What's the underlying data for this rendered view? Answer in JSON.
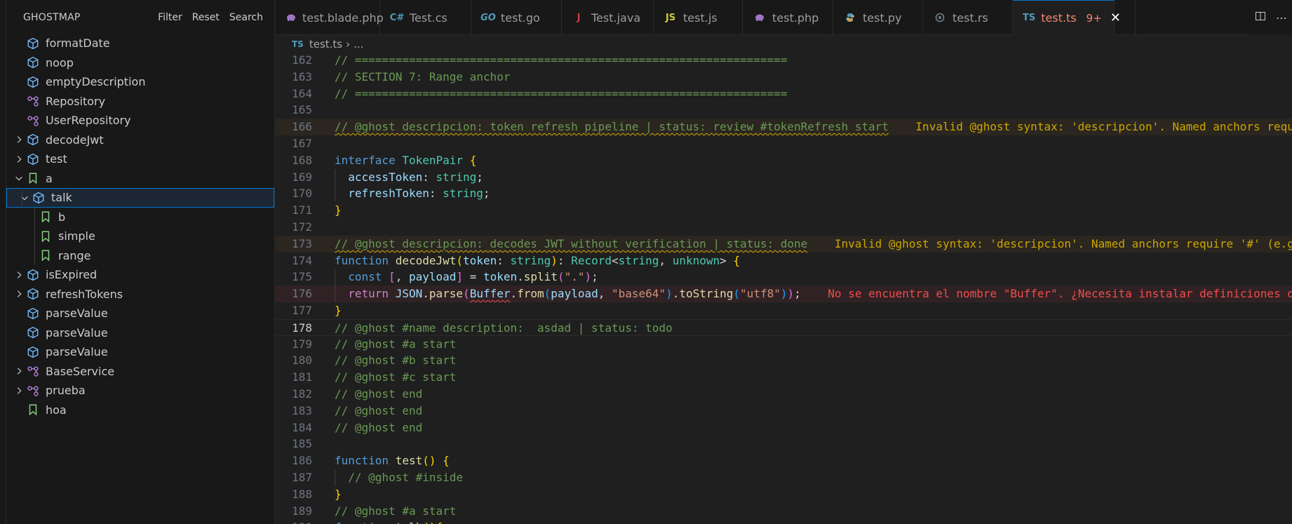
{
  "sidebar": {
    "title": "GHOSTMAP",
    "actions": {
      "filter": "Filter",
      "reset": "Reset",
      "search": "Search"
    },
    "items": [
      {
        "label": "formatDate",
        "icon": "cube-icon",
        "expand": "none",
        "depth": 0
      },
      {
        "label": "noop",
        "icon": "cube-icon",
        "expand": "none",
        "depth": 0
      },
      {
        "label": "emptyDescription",
        "icon": "cube-icon",
        "expand": "none",
        "depth": 0
      },
      {
        "label": "Repository",
        "icon": "class-icon",
        "expand": "none",
        "depth": 0
      },
      {
        "label": "UserRepository",
        "icon": "class-icon",
        "expand": "none",
        "depth": 0
      },
      {
        "label": "decodeJwt",
        "icon": "cube-icon",
        "expand": "collapsed",
        "depth": 0
      },
      {
        "label": "test",
        "icon": "cube-icon",
        "expand": "collapsed",
        "depth": 0
      },
      {
        "label": "a",
        "icon": "bookmark-icon",
        "expand": "expanded",
        "depth": 0
      },
      {
        "label": "talk",
        "icon": "cube-icon",
        "expand": "expanded",
        "depth": 1,
        "selected": true
      },
      {
        "label": "b",
        "icon": "bookmark-icon",
        "expand": "none",
        "depth": 2
      },
      {
        "label": "simple",
        "icon": "bookmark-icon",
        "expand": "none",
        "depth": 2
      },
      {
        "label": "range",
        "icon": "bookmark-icon",
        "expand": "none",
        "depth": 2
      },
      {
        "label": "isExpired",
        "icon": "cube-icon",
        "expand": "collapsed",
        "depth": 0
      },
      {
        "label": "refreshTokens",
        "icon": "cube-icon",
        "expand": "collapsed",
        "depth": 0
      },
      {
        "label": "parseValue",
        "icon": "cube-icon",
        "expand": "none",
        "depth": 0
      },
      {
        "label": "parseValue",
        "icon": "cube-icon",
        "expand": "none",
        "depth": 0
      },
      {
        "label": "parseValue",
        "icon": "cube-icon",
        "expand": "none",
        "depth": 0
      },
      {
        "label": "BaseService",
        "icon": "class-icon",
        "expand": "collapsed",
        "depth": 0
      },
      {
        "label": "prueba",
        "icon": "class-icon",
        "expand": "collapsed",
        "depth": 0
      },
      {
        "label": "hoa",
        "icon": "bookmark-icon",
        "expand": "none",
        "depth": 0
      }
    ]
  },
  "tabs": [
    {
      "label": "test.blade.php",
      "icon": "elephant-icon",
      "icon_color": "#a074c4"
    },
    {
      "label": "Test.cs",
      "icon": "csharp-icon",
      "icon_color": "#519aba"
    },
    {
      "label": "test.go",
      "icon": "go-icon",
      "icon_color": "#519aba"
    },
    {
      "label": "Test.java",
      "icon": "java-icon",
      "icon_color": "#cc3e44"
    },
    {
      "label": "test.js",
      "icon": "js-icon",
      "icon_color": "#cbcb41"
    },
    {
      "label": "test.php",
      "icon": "elephant-icon",
      "icon_color": "#a074c4"
    },
    {
      "label": "test.py",
      "icon": "python-icon",
      "icon_color": "#519aba"
    },
    {
      "label": "test.rs",
      "icon": "rust-icon",
      "icon_color": "#6d8086"
    },
    {
      "label": "test.ts",
      "icon": "ts-icon",
      "icon_color": "#519aba",
      "active": true,
      "badge": "9+"
    }
  ],
  "tab_glyphs": {
    "csharp": "C#",
    "go": "GO",
    "java": "J",
    "js": "JS",
    "ts": "TS"
  },
  "breadcrumb": {
    "file": "test.ts",
    "separator": "›",
    "rest": "..."
  },
  "editor": {
    "current_line": 178,
    "lines": [
      {
        "n": 162,
        "t": [
          [
            "c-com",
            "// ================================================================"
          ]
        ]
      },
      {
        "n": 163,
        "t": [
          [
            "c-com",
            "// SECTION 7: Range anchor"
          ]
        ]
      },
      {
        "n": 164,
        "t": [
          [
            "c-com",
            "// ================================================================"
          ]
        ]
      },
      {
        "n": 165,
        "t": []
      },
      {
        "n": 166,
        "bg": "warn",
        "t": [
          [
            "c-com squig-warn",
            "// @ghost descripcion: token refresh pipeline | status: review #tokenRefresh start"
          ],
          [
            "",
            "    "
          ],
          [
            "inline-warn",
            "Invalid @ghost syntax: 'descripcion'. Named anchors require '#' (e.g. #anchorName)."
          ]
        ]
      },
      {
        "n": 167,
        "t": []
      },
      {
        "n": 168,
        "t": [
          [
            "c-kw",
            "interface"
          ],
          [
            "c-p",
            " "
          ],
          [
            "c-type",
            "TokenPair"
          ],
          [
            "c-p",
            " "
          ],
          [
            "c-br1",
            "{"
          ]
        ]
      },
      {
        "n": 169,
        "guide": true,
        "t": [
          [
            "c-p",
            "  "
          ],
          [
            "c-var",
            "accessToken"
          ],
          [
            "c-p",
            ": "
          ],
          [
            "c-type",
            "string"
          ],
          [
            "c-p",
            ";"
          ]
        ]
      },
      {
        "n": 170,
        "guide": true,
        "t": [
          [
            "c-p",
            "  "
          ],
          [
            "c-var",
            "refreshToken"
          ],
          [
            "c-p",
            ": "
          ],
          [
            "c-type",
            "string"
          ],
          [
            "c-p",
            ";"
          ]
        ]
      },
      {
        "n": 171,
        "t": [
          [
            "c-br1",
            "}"
          ]
        ]
      },
      {
        "n": 172,
        "t": []
      },
      {
        "n": 173,
        "bg": "warn",
        "t": [
          [
            "c-com squig-warn",
            "// @ghost descripcion: decodes JWT without verification | status: done"
          ],
          [
            "",
            "    "
          ],
          [
            "inline-warn",
            "Invalid @ghost syntax: 'descripcion'. Named anchors require '#' (e.g. #anchorName)."
          ]
        ]
      },
      {
        "n": 174,
        "t": [
          [
            "c-kw",
            "function"
          ],
          [
            "c-p",
            " "
          ],
          [
            "c-fn",
            "decodeJwt"
          ],
          [
            "c-br1",
            "("
          ],
          [
            "c-var",
            "token"
          ],
          [
            "c-p",
            ": "
          ],
          [
            "c-type",
            "string"
          ],
          [
            "c-br1",
            ")"
          ],
          [
            "c-p",
            ": "
          ],
          [
            "c-type",
            "Record"
          ],
          [
            "c-p",
            "<"
          ],
          [
            "c-type",
            "string"
          ],
          [
            "c-p",
            ", "
          ],
          [
            "c-type",
            "unknown"
          ],
          [
            "c-p",
            "> "
          ],
          [
            "c-br1",
            "{"
          ]
        ]
      },
      {
        "n": 175,
        "guide": true,
        "t": [
          [
            "c-p",
            "  "
          ],
          [
            "c-kw",
            "const"
          ],
          [
            "c-p",
            " "
          ],
          [
            "c-br2",
            "["
          ],
          [
            "c-p",
            ", "
          ],
          [
            "c-var",
            "payload"
          ],
          [
            "c-br2",
            "]"
          ],
          [
            "c-p",
            " = "
          ],
          [
            "c-var",
            "token"
          ],
          [
            "c-p",
            "."
          ],
          [
            "c-fn",
            "split"
          ],
          [
            "c-br2",
            "("
          ],
          [
            "c-str",
            "\".\""
          ],
          [
            "c-br2",
            ")"
          ],
          [
            "c-p",
            ";"
          ]
        ]
      },
      {
        "n": 176,
        "bg": "err",
        "guide": true,
        "t": [
          [
            "c-p",
            "  "
          ],
          [
            "c-kw2",
            "return"
          ],
          [
            "c-p",
            " "
          ],
          [
            "c-var",
            "JSON"
          ],
          [
            "c-p",
            "."
          ],
          [
            "c-fn",
            "parse"
          ],
          [
            "c-br2",
            "("
          ],
          [
            "c-var squig-err",
            "Buffer"
          ],
          [
            "c-p",
            "."
          ],
          [
            "c-fn",
            "from"
          ],
          [
            "c-br3",
            "("
          ],
          [
            "c-var",
            "payload"
          ],
          [
            "c-p",
            ", "
          ],
          [
            "c-str",
            "\"base64\""
          ],
          [
            "c-br3",
            ")"
          ],
          [
            "c-p",
            "."
          ],
          [
            "c-fn",
            "toString"
          ],
          [
            "c-br3",
            "("
          ],
          [
            "c-str",
            "\"utf8\""
          ],
          [
            "c-br3",
            ")"
          ],
          [
            "c-br2",
            ")"
          ],
          [
            "c-p",
            ";"
          ],
          [
            "",
            "    "
          ],
          [
            "inline-err",
            "No se encuentra el nombre \"Buffer\". ¿Necesita instalar definiciones de tipo para Node?"
          ]
        ]
      },
      {
        "n": 177,
        "t": [
          [
            "c-br1",
            "}"
          ]
        ]
      },
      {
        "n": 178,
        "current": true,
        "t": [
          [
            "c-com",
            "// @ghost #name description:  asdad | status: todo"
          ]
        ]
      },
      {
        "n": 179,
        "t": [
          [
            "c-com",
            "// @ghost #a start"
          ]
        ]
      },
      {
        "n": 180,
        "t": [
          [
            "c-com",
            "// @ghost #b start"
          ]
        ]
      },
      {
        "n": 181,
        "t": [
          [
            "c-com",
            "// @ghost #c start"
          ]
        ]
      },
      {
        "n": 182,
        "t": [
          [
            "c-com",
            "// @ghost end"
          ]
        ]
      },
      {
        "n": 183,
        "t": [
          [
            "c-com",
            "// @ghost end"
          ]
        ]
      },
      {
        "n": 184,
        "t": [
          [
            "c-com",
            "// @ghost end"
          ]
        ]
      },
      {
        "n": 185,
        "t": []
      },
      {
        "n": 186,
        "t": [
          [
            "c-kw",
            "function"
          ],
          [
            "c-p",
            " "
          ],
          [
            "c-fn",
            "test"
          ],
          [
            "c-br1",
            "()"
          ],
          [
            "c-p",
            " "
          ],
          [
            "c-br1",
            "{"
          ]
        ]
      },
      {
        "n": 187,
        "guide": true,
        "t": [
          [
            "c-p",
            "  "
          ],
          [
            "c-com",
            "// @ghost #inside"
          ]
        ]
      },
      {
        "n": 188,
        "t": [
          [
            "c-br1",
            "}"
          ]
        ]
      },
      {
        "n": 189,
        "t": [
          [
            "c-com",
            "// @ghost #a start"
          ]
        ]
      },
      {
        "n": 190,
        "t": [
          [
            "c-kw",
            "function"
          ],
          [
            "c-p",
            " "
          ],
          [
            "c-fn",
            "talk"
          ],
          [
            "c-br1",
            "(){"
          ]
        ]
      }
    ]
  }
}
